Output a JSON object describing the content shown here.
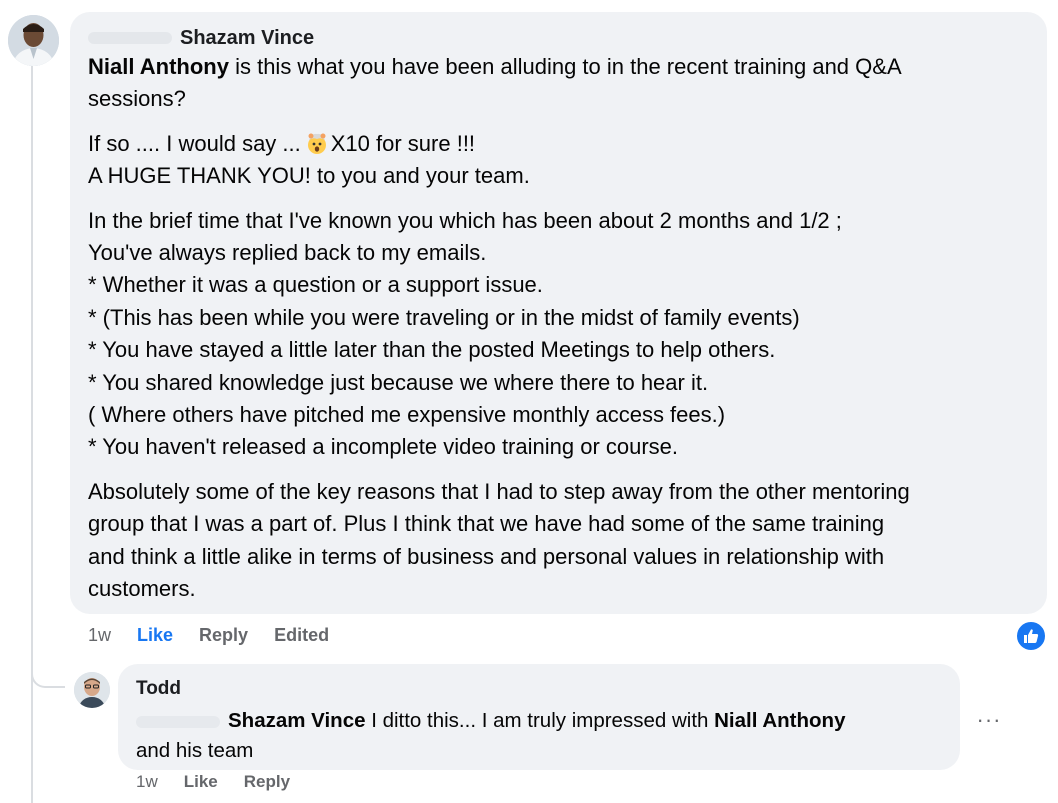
{
  "comment": {
    "author": "Shazam Vince",
    "paragraphs": [
      {
        "lines": [
          {
            "mention": "Niall Anthony",
            "text": " is this what you have been alluding to in the recent training and Q&A"
          },
          {
            "text": "sessions?"
          }
        ]
      },
      {
        "lines": [
          {
            "text_before_emoji": "If so .... I would say ...",
            "emoji": "exploding-head-emoji",
            "text_after_emoji": "X10 for sure !!!"
          },
          {
            "text": "A HUGE THANK YOU! to you and your team."
          }
        ]
      },
      {
        "lines": [
          {
            "text": "In the brief time that I've known you which has been about 2 months and 1/2 ;"
          },
          {
            "text": "You've always replied back to my emails."
          },
          {
            "text": "* Whether it was a question or a support issue."
          },
          {
            "text": "* (This has been while you were traveling or in the midst of family events)"
          },
          {
            "text": "* You have stayed a little later than the posted Meetings to help others."
          },
          {
            "text": "* You shared knowledge just because we where there to hear it."
          },
          {
            "text": "( Where others have pitched me expensive monthly access fees.)"
          },
          {
            "text": "* You haven't released a incomplete video training or course."
          }
        ]
      },
      {
        "lines": [
          {
            "text": "Absolutely some of the key reasons that I had to step away from the other mentoring"
          },
          {
            "text": "group that I was a part of. Plus I think that we have had some of the same training"
          },
          {
            "text": "and think a little alike in terms of business and personal values in relationship with"
          },
          {
            "text": "customers."
          }
        ]
      }
    ],
    "actions": {
      "time": "1w",
      "like": "Like",
      "reply": "Reply",
      "edited": "Edited"
    },
    "reaction_icon": "thumbs-up-icon",
    "like_color": "#1877f2"
  },
  "reply": {
    "author": "Todd",
    "mention_1": "Shazam Vince",
    "text_1": " I ditto this... I am truly impressed with ",
    "mention_2": "Niall Anthony",
    "text_2": "and his team",
    "more_label": "···",
    "actions": {
      "time": "1w",
      "like": "Like",
      "reply": "Reply"
    }
  }
}
